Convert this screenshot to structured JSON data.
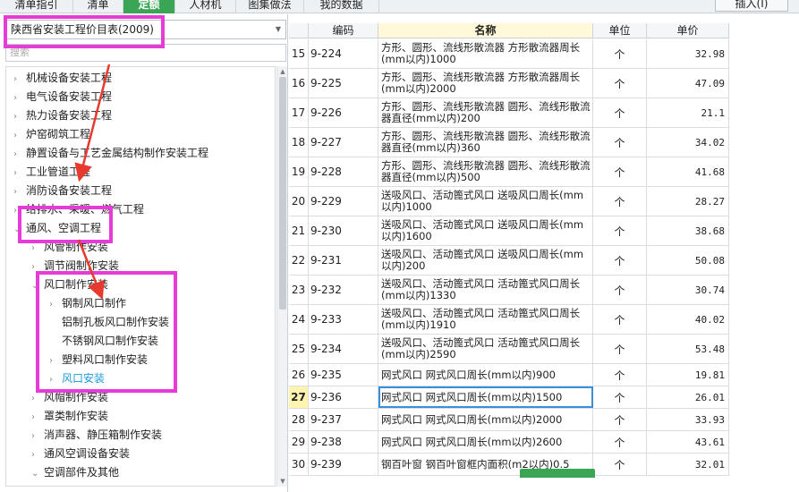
{
  "tabs": [
    "清单指引",
    "清单",
    "定额",
    "人材机",
    "图集做法",
    "我的数据"
  ],
  "active_tab": 2,
  "insert_button": "插入(I)",
  "library_select": "陕西省安装工程价目表(2009)",
  "search_placeholder": "搜索",
  "tree": [
    {
      "label": "机械设备安装工程",
      "toggle": "›"
    },
    {
      "label": "电气设备安装工程",
      "toggle": "›"
    },
    {
      "label": "热力设备安装工程",
      "toggle": "›"
    },
    {
      "label": "炉窑砌筑工程",
      "toggle": "›"
    },
    {
      "label": "静置设备与工艺金属结构制作安装工程",
      "toggle": "›"
    },
    {
      "label": "工业管道工程",
      "toggle": "›"
    },
    {
      "label": "消防设备安装工程",
      "toggle": "›"
    },
    {
      "label": "给排水、采暖、燃气工程",
      "toggle": "›"
    },
    {
      "label": "通风、空调工程",
      "toggle": "⌄"
    },
    {
      "label": "风管制作安装",
      "toggle": "›"
    },
    {
      "label": "调节阀制作安装",
      "toggle": "›"
    },
    {
      "label": "风口制作安装",
      "toggle": "⌄"
    },
    {
      "label": "钢制风口制作",
      "toggle": "›"
    },
    {
      "label": "铝制孔板风口制作安装",
      "toggle": ""
    },
    {
      "label": "不锈钢风口制作安装",
      "toggle": ""
    },
    {
      "label": "塑料风口制作安装",
      "toggle": "›"
    },
    {
      "label": "风口安装",
      "toggle": "›"
    },
    {
      "label": "风帽制作安装",
      "toggle": "›"
    },
    {
      "label": "罩类制作安装",
      "toggle": "›"
    },
    {
      "label": "消声器、静压箱制作安装",
      "toggle": "›"
    },
    {
      "label": "通风空调设备安装",
      "toggle": "›"
    },
    {
      "label": "空调部件及其他",
      "toggle": "⌄"
    }
  ],
  "selected_tree_item": 16,
  "table": {
    "headers": [
      "",
      "编码",
      "名称",
      "单位",
      "单价"
    ],
    "rows": [
      {
        "idx": "15",
        "code": "9-224",
        "name": "方形、圆形、流线形散流器 方形散流器周长(mm以内)1000",
        "unit": "个",
        "price": "32.98"
      },
      {
        "idx": "16",
        "code": "9-225",
        "name": "方形、圆形、流线形散流器 方形散流器周长(mm以内)2000",
        "unit": "个",
        "price": "47.09"
      },
      {
        "idx": "17",
        "code": "9-226",
        "name": "方形、圆形、流线形散流器 圆形、流线形散流器直径(mm以内)200",
        "unit": "个",
        "price": "21.1"
      },
      {
        "idx": "18",
        "code": "9-227",
        "name": "方形、圆形、流线形散流器 圆形、流线形散流器直径(mm以内)360",
        "unit": "个",
        "price": "34.02"
      },
      {
        "idx": "19",
        "code": "9-228",
        "name": "方形、圆形、流线形散流器 圆形、流线形散流器直径(mm以内)500",
        "unit": "个",
        "price": "41.68"
      },
      {
        "idx": "20",
        "code": "9-229",
        "name": "送吸风口、活动篦式风口 送吸风口周长(mm以内)1000",
        "unit": "个",
        "price": "28.27"
      },
      {
        "idx": "21",
        "code": "9-230",
        "name": "送吸风口、活动篦式风口 送吸风口周长(mm以内)1600",
        "unit": "个",
        "price": "38.68"
      },
      {
        "idx": "22",
        "code": "9-231",
        "name": "送吸风口、活动篦式风口 送吸风口周长(mm以内)200",
        "unit": "个",
        "price": "50.08"
      },
      {
        "idx": "23",
        "code": "9-232",
        "name": "送吸风口、活动篦式风口 活动篦式风口周长(mm以内)1330",
        "unit": "个",
        "price": "30.74"
      },
      {
        "idx": "24",
        "code": "9-233",
        "name": "送吸风口、活动篦式风口 活动篦式风口周长(mm以内)1910",
        "unit": "个",
        "price": "40.02"
      },
      {
        "idx": "25",
        "code": "9-234",
        "name": "送吸风口、活动篦式风口 活动篦式风口周长(mm以内)2590",
        "unit": "个",
        "price": "53.48"
      },
      {
        "idx": "26",
        "code": "9-235",
        "name": "网式风口 网式风口周长(mm以内)900",
        "unit": "个",
        "price": "19.81"
      },
      {
        "idx": "27",
        "code": "9-236",
        "name": "网式风口 网式风口周长(mm以内)1500",
        "unit": "个",
        "price": "26.01"
      },
      {
        "idx": "28",
        "code": "9-237",
        "name": "网式风口 网式风口周长(mm以内)2000",
        "unit": "个",
        "price": "33.93"
      },
      {
        "idx": "29",
        "code": "9-238",
        "name": "网式风口 网式风口周长(mm以内)2600",
        "unit": "个",
        "price": "43.61"
      },
      {
        "idx": "30",
        "code": "9-239",
        "name": "钢百叶窗 钢百叶窗框内面积(m2以内)0.5",
        "unit": "个",
        "price": "32.01"
      }
    ]
  },
  "current_row": 12,
  "colors": {
    "accent_green": "#3aa655",
    "highlight_magenta": "#e63bd6",
    "arrow_red": "#e8392f",
    "selected_blue": "#1d9bd8"
  }
}
